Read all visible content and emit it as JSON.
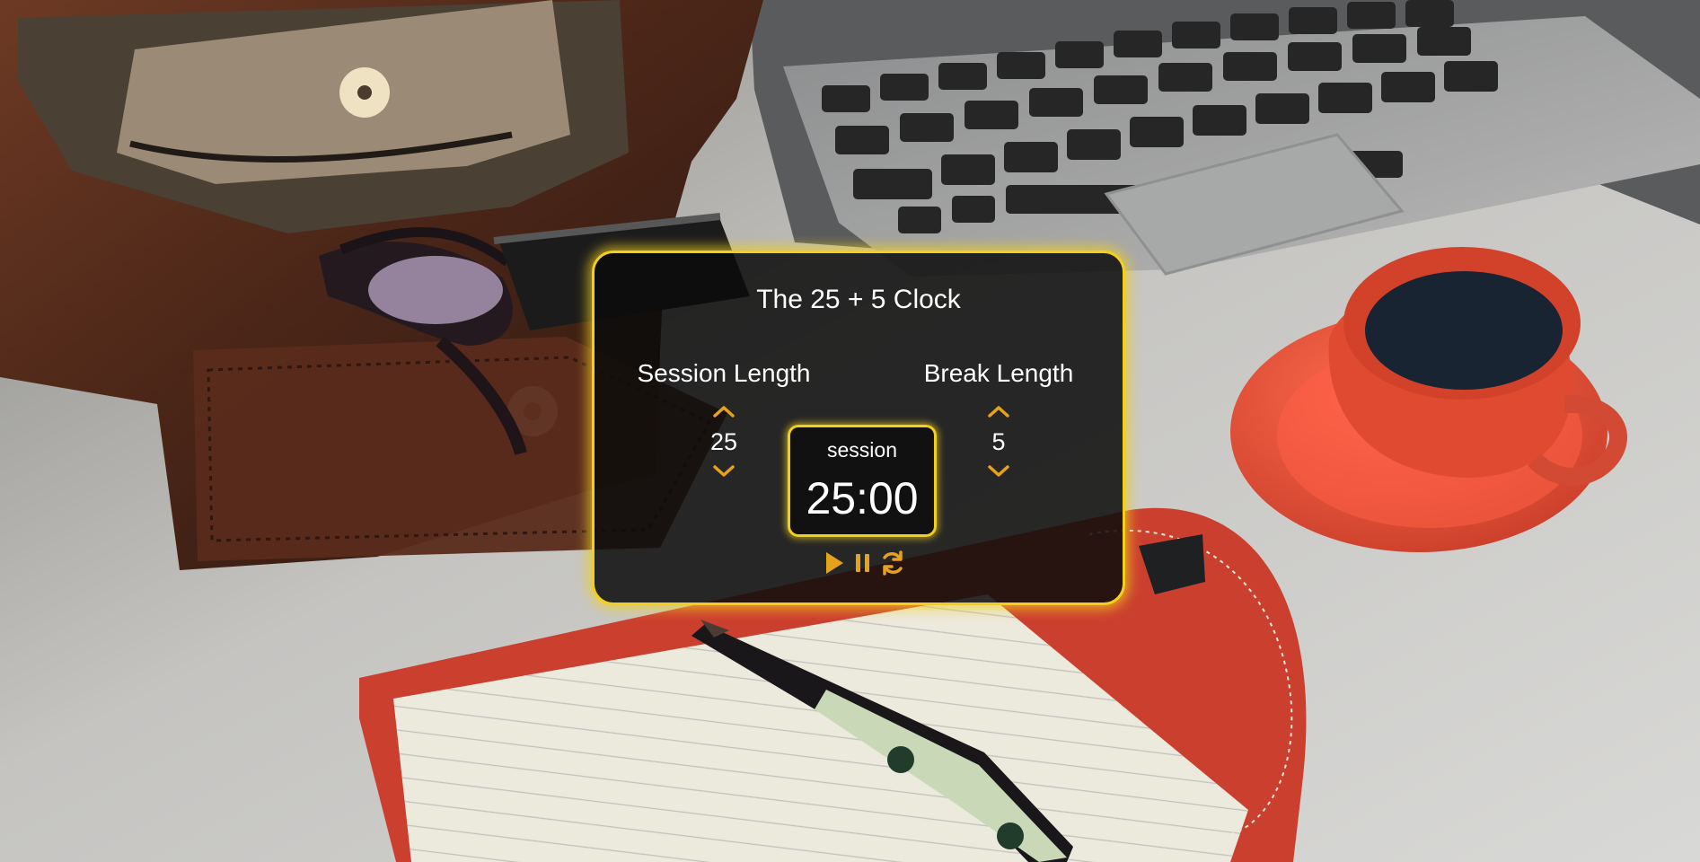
{
  "app": {
    "title": "The 25 + 5 Clock"
  },
  "session": {
    "label": "Session Length",
    "value": "25"
  },
  "break": {
    "label": "Break Length",
    "value": "5"
  },
  "timer": {
    "label": "session",
    "time_left": "25:00"
  },
  "icons": {
    "increment": "chevron-up-icon",
    "decrement": "chevron-down-icon",
    "start": "play-icon",
    "pause": "pause-icon",
    "reset": "refresh-icon"
  },
  "colors": {
    "accent": "#f2cf1d",
    "icon": "#e6a21a",
    "card_background": "#0c0c0c",
    "text": "#ffffff"
  }
}
